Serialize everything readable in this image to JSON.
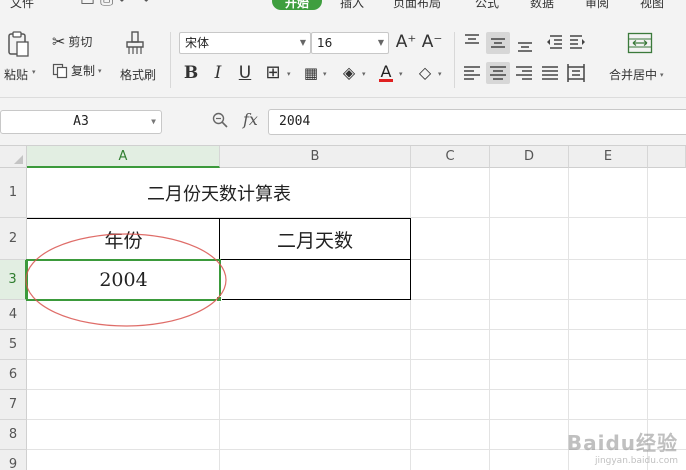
{
  "menubar": {
    "items": [
      "文件",
      "开始",
      "插入",
      "页面布局",
      "公式",
      "数据",
      "审阅",
      "视图"
    ]
  },
  "ribbon": {
    "paste": "粘贴",
    "cut": "剪切",
    "copy": "复制",
    "format_painter": "格式刷",
    "font_name": "宋体",
    "font_size": "16",
    "merge_center": "合并居中",
    "increase_font": "A⁺",
    "decrease_font": "A⁻",
    "bold": "B",
    "italic": "I",
    "underline": "U"
  },
  "formula_bar": {
    "name_box": "A3",
    "fx_label": "fx",
    "value": "2004"
  },
  "grid": {
    "columns": [
      "A",
      "B",
      "C",
      "D",
      "E"
    ],
    "rows": [
      "1",
      "2",
      "3",
      "4",
      "5",
      "6",
      "7",
      "8",
      "9"
    ],
    "cells": {
      "A1": "二月份天数计算表",
      "A2": "年份",
      "B2": "二月天数",
      "A3": "2004",
      "B3": ""
    },
    "selected_cell": "A3"
  },
  "colors": {
    "accent_green": "#3b9a3b",
    "annotation_red": "#d9534f",
    "font_color_bar": "#e02020"
  },
  "watermark": {
    "brand": "Baidu经验",
    "url": "jingyan.baidu.com"
  }
}
